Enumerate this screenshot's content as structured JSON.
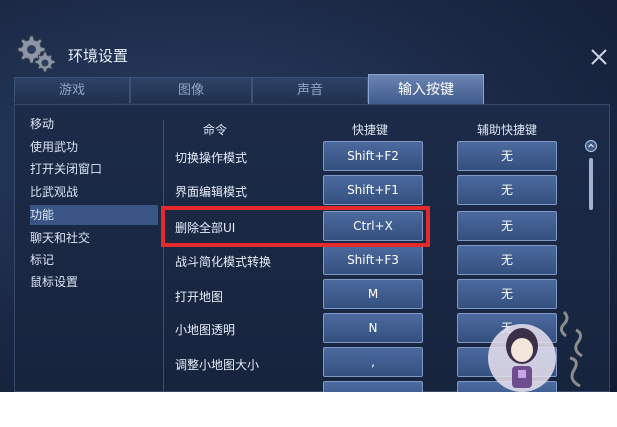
{
  "window": {
    "title": "环境设置",
    "close_icon": "close-icon",
    "settings_icon": "gear-icon"
  },
  "tabs": [
    {
      "label": "游戏",
      "active": false
    },
    {
      "label": "图像",
      "active": false
    },
    {
      "label": "声音",
      "active": false
    },
    {
      "label": "输入按键",
      "active": true
    }
  ],
  "sidebar": {
    "items": [
      {
        "label": "移动",
        "selected": false
      },
      {
        "label": "使用武功",
        "selected": false
      },
      {
        "label": "打开关闭窗口",
        "selected": false
      },
      {
        "label": "比武观战",
        "selected": false
      },
      {
        "label": "功能",
        "selected": true
      },
      {
        "label": "聊天和社交",
        "selected": false
      },
      {
        "label": "标记",
        "selected": false
      },
      {
        "label": "鼠标设置",
        "selected": false
      }
    ]
  },
  "table": {
    "headers": {
      "command": "命令",
      "shortcut": "快捷键",
      "aux_shortcut": "辅助快捷键"
    },
    "rows": [
      {
        "command": "切换操作模式",
        "shortcut": "Shift+F2",
        "aux": "无"
      },
      {
        "command": "界面编辑模式",
        "shortcut": "Shift+F1",
        "aux": "无"
      },
      {
        "command": "删除全部UI",
        "shortcut": "Ctrl+X",
        "aux": "无"
      },
      {
        "command": "战斗简化模式转换",
        "shortcut": "Shift+F3",
        "aux": "无"
      },
      {
        "command": "打开地图",
        "shortcut": "M",
        "aux": "无"
      },
      {
        "command": "小地图透明",
        "shortcut": "N",
        "aux": "无"
      },
      {
        "command": "调整小地图大小",
        "shortcut": ",",
        "aux": ""
      }
    ]
  },
  "highlight_color": "#e42a2a"
}
